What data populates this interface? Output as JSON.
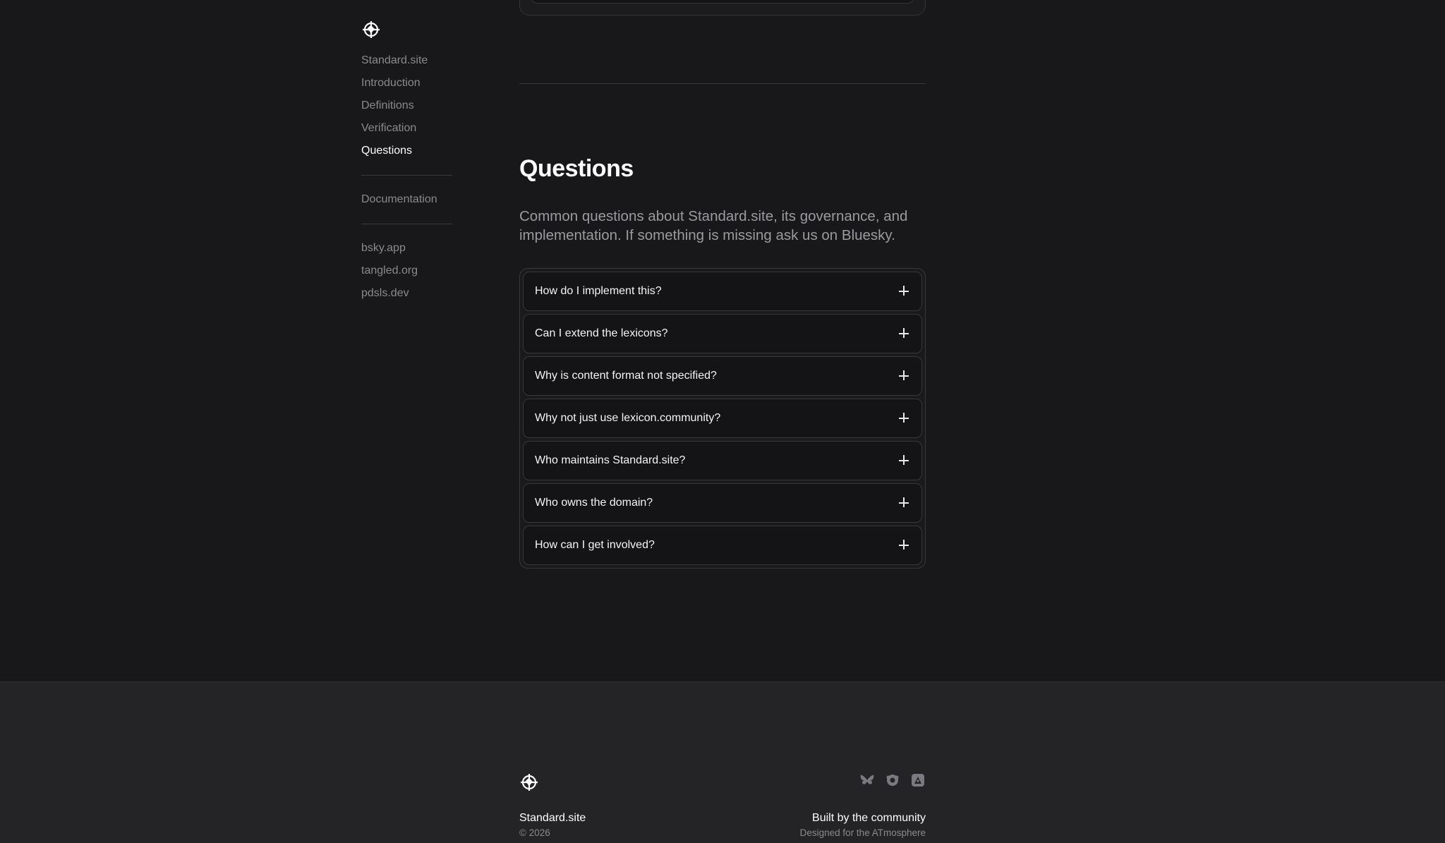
{
  "sidebar": {
    "items": [
      {
        "label": "Standard.site"
      },
      {
        "label": "Introduction"
      },
      {
        "label": "Definitions"
      },
      {
        "label": "Verification"
      },
      {
        "label": "Questions"
      }
    ],
    "docs": [
      {
        "label": "Documentation"
      }
    ],
    "links": [
      {
        "label": "bsky.app"
      },
      {
        "label": "tangled.org"
      },
      {
        "label": "pdsls.dev"
      }
    ]
  },
  "questions": {
    "title": "Questions",
    "description": "Common questions about Standard.site, its governance, and implementation. If something is missing ask us on Bluesky.",
    "items": [
      {
        "question": "How do I implement this?"
      },
      {
        "question": "Can I extend the lexicons?"
      },
      {
        "question": "Why is content format not specified?"
      },
      {
        "question": "Why not just use lexicon.community?"
      },
      {
        "question": "Who maintains Standard.site?"
      },
      {
        "question": "Who owns the domain?"
      },
      {
        "question": "How can I get involved?"
      }
    ]
  },
  "footer": {
    "name": "Standard.site",
    "copyright": "© 2026",
    "built": "Built by the community",
    "designed": "Designed for the ATmosphere",
    "icons": [
      "bluesky-icon",
      "tangled-icon",
      "pdsls-icon"
    ]
  },
  "colors": {
    "background": "#18181b",
    "footer_background": "#242427",
    "text_primary": "#ffffff",
    "text_muted": "#8a8a8e"
  }
}
